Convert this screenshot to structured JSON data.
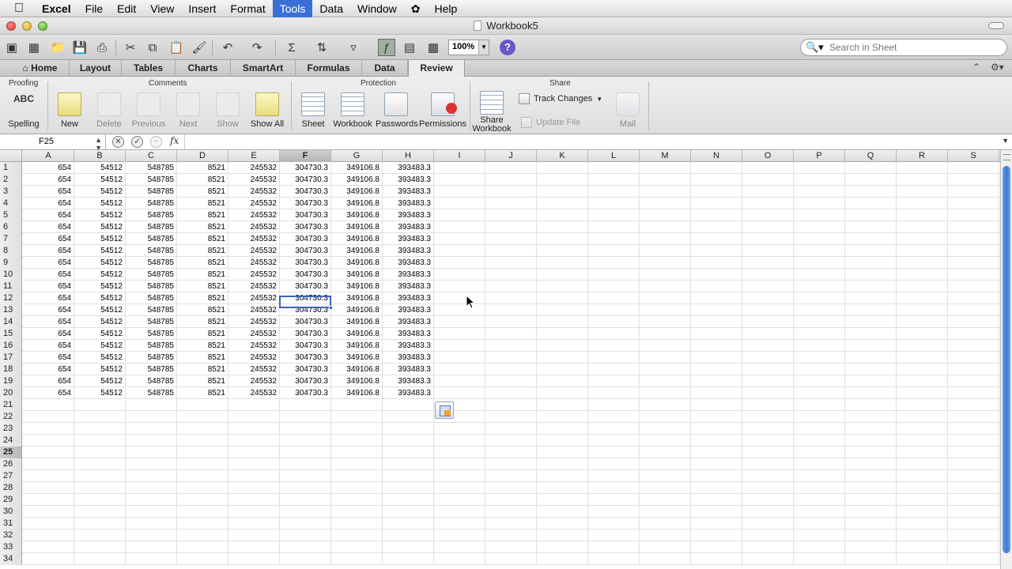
{
  "menubar": {
    "app": "Excel",
    "items": [
      "File",
      "Edit",
      "View",
      "Insert",
      "Format",
      "Tools",
      "Data",
      "Window",
      "Help"
    ],
    "active": "Tools"
  },
  "window": {
    "title": "Workbook5"
  },
  "toolbar": {
    "zoom": "100%",
    "help": "?",
    "search_placeholder": "Search in Sheet"
  },
  "ribbon": {
    "tabs": [
      "Home",
      "Layout",
      "Tables",
      "Charts",
      "SmartArt",
      "Formulas",
      "Data",
      "Review"
    ],
    "active_tab": "Review",
    "groups": {
      "proofing": {
        "title": "Proofing",
        "spelling": "Spelling",
        "spelling_icon_text": "ABC"
      },
      "comments": {
        "title": "Comments",
        "new": "New",
        "delete": "Delete",
        "previous": "Previous",
        "next": "Next",
        "show": "Show",
        "show_all": "Show All"
      },
      "protection": {
        "title": "Protection",
        "sheet": "Sheet",
        "workbook": "Workbook",
        "passwords": "Passwords",
        "permissions": "Permissions"
      },
      "share": {
        "title": "Share",
        "share_workbook_line1": "Share",
        "share_workbook_line2": "Workbook",
        "track_changes": "Track Changes",
        "update_file": "Update File",
        "mail": "Mail"
      }
    }
  },
  "formula_bar": {
    "name_box": "F25",
    "fx": "fx",
    "value": ""
  },
  "sheet": {
    "columns": [
      "A",
      "B",
      "C",
      "D",
      "E",
      "F",
      "G",
      "H",
      "I",
      "J",
      "K",
      "L",
      "M",
      "N",
      "O",
      "P",
      "Q",
      "R",
      "S"
    ],
    "selected_column": "F",
    "selected_row": 25,
    "row_count": 34,
    "data_rows": 20,
    "row_values": [
      "654",
      "54512",
      "548785",
      "8521",
      "245532",
      "304730.3",
      "349106.8",
      "393483.3"
    ]
  },
  "colors": {
    "accent": "#3a62c0",
    "menu_active": "#3a6fd8",
    "scroll_thumb": "#3c78d8"
  }
}
